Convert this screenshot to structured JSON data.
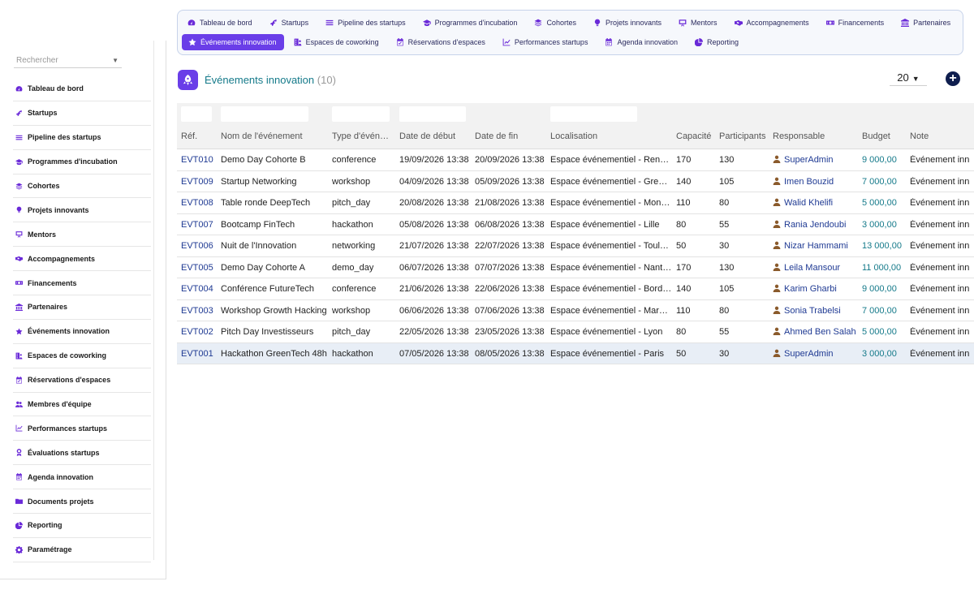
{
  "search": {
    "placeholder": "Rechercher"
  },
  "sidebar": {
    "items": [
      {
        "label": "Tableau de bord",
        "icon": "gauge-icon"
      },
      {
        "label": "Startups",
        "icon": "rocket-icon"
      },
      {
        "label": "Pipeline des startups",
        "icon": "list-icon"
      },
      {
        "label": "Programmes d'incubation",
        "icon": "graduation-cap-icon"
      },
      {
        "label": "Cohortes",
        "icon": "layers-icon"
      },
      {
        "label": "Projets innovants",
        "icon": "lightbulb-icon"
      },
      {
        "label": "Mentors",
        "icon": "presentation-icon"
      },
      {
        "label": "Accompagnements",
        "icon": "handshake-icon"
      },
      {
        "label": "Financements",
        "icon": "money-icon"
      },
      {
        "label": "Partenaires",
        "icon": "building-icon"
      },
      {
        "label": "Événements innovation",
        "icon": "star-icon"
      },
      {
        "label": "Espaces de coworking",
        "icon": "building-user-icon"
      },
      {
        "label": "Réservations d'espaces",
        "icon": "calendar-check-icon"
      },
      {
        "label": "Membres d'équipe",
        "icon": "users-icon"
      },
      {
        "label": "Performances startups",
        "icon": "chart-line-icon"
      },
      {
        "label": "Évaluations startups",
        "icon": "award-icon"
      },
      {
        "label": "Agenda innovation",
        "icon": "calendar-icon"
      },
      {
        "label": "Documents projets",
        "icon": "folder-icon"
      },
      {
        "label": "Reporting",
        "icon": "pie-chart-icon"
      },
      {
        "label": "Paramétrage",
        "icon": "gear-icon"
      }
    ]
  },
  "topnav": {
    "row1": [
      {
        "label": "Tableau de bord",
        "icon": "gauge-icon"
      },
      {
        "label": "Startups",
        "icon": "rocket-icon"
      },
      {
        "label": "Pipeline des startups",
        "icon": "list-icon"
      },
      {
        "label": "Programmes d'incubation",
        "icon": "graduation-cap-icon"
      },
      {
        "label": "Cohortes",
        "icon": "layers-icon"
      },
      {
        "label": "Projets innovants",
        "icon": "lightbulb-icon"
      },
      {
        "label": "Mentors",
        "icon": "presentation-icon"
      },
      {
        "label": "Accompagnements",
        "icon": "handshake-icon"
      },
      {
        "label": "Financements",
        "icon": "money-icon"
      },
      {
        "label": "Partenaires",
        "icon": "building-icon"
      }
    ],
    "row2": [
      {
        "label": "Événements innovation",
        "icon": "star-icon",
        "active": true
      },
      {
        "label": "Espaces de coworking",
        "icon": "building-user-icon"
      },
      {
        "label": "Réservations d'espaces",
        "icon": "calendar-check-icon"
      },
      {
        "label": "Performances startups",
        "icon": "chart-line-icon"
      },
      {
        "label": "Agenda innovation",
        "icon": "calendar-icon"
      },
      {
        "label": "Reporting",
        "icon": "pie-chart-icon"
      }
    ]
  },
  "page": {
    "title": "Événements innovation",
    "count": "(10)",
    "per_page": "20",
    "icon": "rocket-icon"
  },
  "colors": {
    "accent": "#6a3ee8",
    "title": "#157a8a",
    "link": "#1f3a93",
    "selected_row": "#e8eef6"
  },
  "table": {
    "columns": [
      "Réf.",
      "Nom de l'événement",
      "Type d'évén…",
      "Date de début",
      "Date de fin",
      "Localisation",
      "Capacité",
      "Participants",
      "Responsable",
      "Budget",
      "Note"
    ],
    "rows": [
      [
        "EVT010",
        "Demo Day Cohorte B",
        "conference",
        "19/09/2026 13:38",
        "20/09/2026 13:38",
        "Espace événementiel - Ren…",
        "170",
        "130",
        "SuperAdmin",
        "9 000,00",
        "Événement inn"
      ],
      [
        "EVT009",
        "Startup Networking",
        "workshop",
        "04/09/2026 13:38",
        "05/09/2026 13:38",
        "Espace événementiel - Gre…",
        "140",
        "105",
        "Imen Bouzid",
        "7 000,00",
        "Événement inn"
      ],
      [
        "EVT008",
        "Table ronde DeepTech",
        "pitch_day",
        "20/08/2026 13:38",
        "21/08/2026 13:38",
        "Espace événementiel - Mon…",
        "110",
        "80",
        "Walid Khelifi",
        "5 000,00",
        "Événement inn"
      ],
      [
        "EVT007",
        "Bootcamp FinTech",
        "hackathon",
        "05/08/2026 13:38",
        "06/08/2026 13:38",
        "Espace événementiel - Lille",
        "80",
        "55",
        "Rania Jendoubi",
        "3 000,00",
        "Événement inn"
      ],
      [
        "EVT006",
        "Nuit de l'Innovation",
        "networking",
        "21/07/2026 13:38",
        "22/07/2026 13:38",
        "Espace événementiel - Toul…",
        "50",
        "30",
        "Nizar Hammami",
        "13 000,00",
        "Événement inn"
      ],
      [
        "EVT005",
        "Demo Day Cohorte A",
        "demo_day",
        "06/07/2026 13:38",
        "07/07/2026 13:38",
        "Espace événementiel - Nant…",
        "170",
        "130",
        "Leila Mansour",
        "11 000,00",
        "Événement inn"
      ],
      [
        "EVT004",
        "Conférence FutureTech",
        "conference",
        "21/06/2026 13:38",
        "22/06/2026 13:38",
        "Espace événementiel - Bord…",
        "140",
        "105",
        "Karim Gharbi",
        "9 000,00",
        "Événement inn"
      ],
      [
        "EVT003",
        "Workshop Growth Hacking",
        "workshop",
        "06/06/2026 13:38",
        "07/06/2026 13:38",
        "Espace événementiel - Mar…",
        "110",
        "80",
        "Sonia Trabelsi",
        "7 000,00",
        "Événement inn"
      ],
      [
        "EVT002",
        "Pitch Day Investisseurs",
        "pitch_day",
        "22/05/2026 13:38",
        "23/05/2026 13:38",
        "Espace événementiel - Lyon",
        "80",
        "55",
        "Ahmed Ben Salah",
        "5 000,00",
        "Événement inn"
      ],
      [
        "EVT001",
        "Hackathon GreenTech 48h",
        "hackathon",
        "07/05/2026 13:38",
        "08/05/2026 13:38",
        "Espace événementiel - Paris",
        "50",
        "30",
        "SuperAdmin",
        "3 000,00",
        "Événement inn"
      ]
    ],
    "selected_row": 9
  }
}
